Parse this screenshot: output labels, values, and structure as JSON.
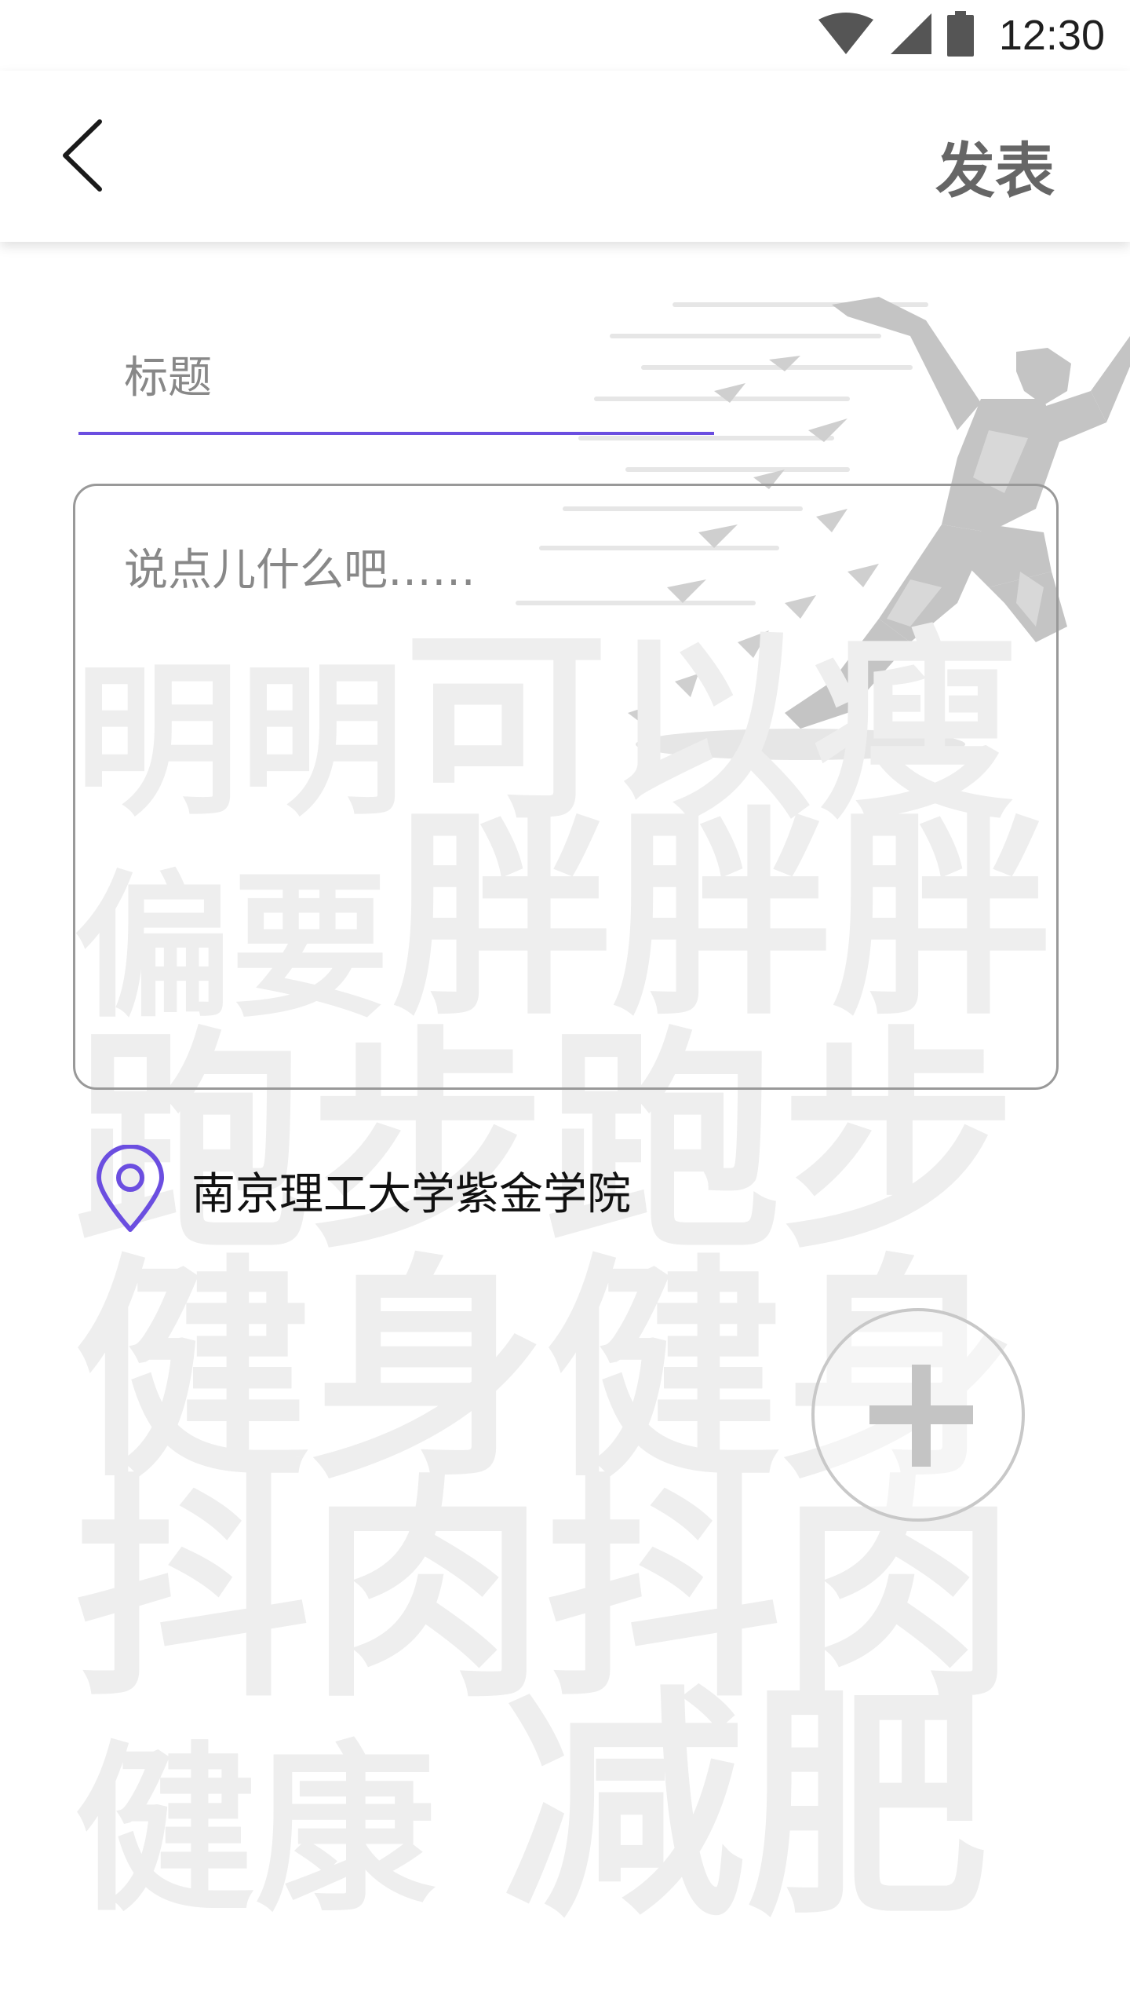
{
  "status_bar": {
    "time": "12:30",
    "icons": [
      "wifi-icon",
      "cell-signal-icon",
      "battery-icon"
    ]
  },
  "app_bar": {
    "back_icon": "chevron-left-icon",
    "publish_label": "发表"
  },
  "form": {
    "title_placeholder": "标题",
    "content_placeholder": "说点儿什么吧……",
    "location_icon": "location-pin-icon",
    "location_text": "南京理工大学紫金学院",
    "add_icon": "plus-icon"
  },
  "background": {
    "row1": [
      "明",
      "明",
      "可",
      "以",
      "瘦"
    ],
    "row2a": [
      "偏",
      "要"
    ],
    "row2b": [
      "胖",
      "胖",
      "胖"
    ],
    "row3": [
      "跑",
      "步",
      "跑",
      "步"
    ],
    "row4": [
      "健",
      "身",
      "健",
      "身"
    ],
    "row5": [
      "抖",
      "肉",
      "抖",
      "肉"
    ],
    "row6a": [
      "健",
      "康"
    ],
    "row6b": [
      "减",
      "肥"
    ]
  },
  "colors": {
    "accent": "#6b4ee0",
    "publish_text": "#666666",
    "background_words": "#eeeeee",
    "border": "#999999"
  }
}
